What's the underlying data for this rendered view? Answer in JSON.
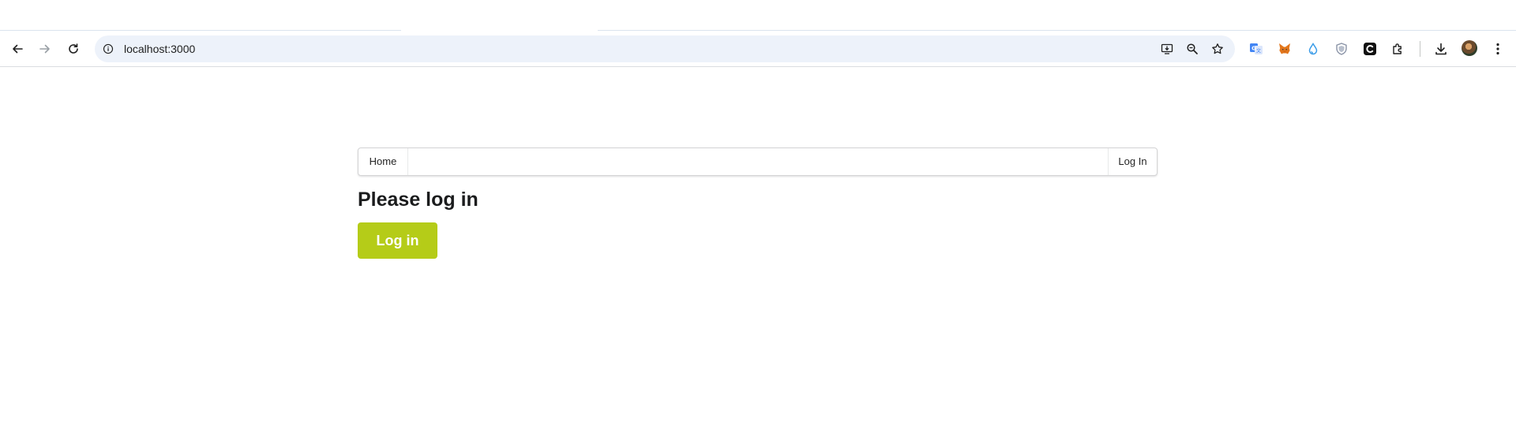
{
  "browser": {
    "url": "localhost:3000",
    "icons": {
      "back": "arrow-left-icon",
      "forward": "arrow-right-icon",
      "reload": "reload-icon",
      "site_info": "info-icon",
      "install": "install-app-icon",
      "zoom": "zoom-icon",
      "bookmark": "star-icon",
      "downloads": "download-icon",
      "menu": "kebab-menu-icon"
    },
    "extensions": [
      "google-translate-icon",
      "metamask-icon",
      "drop-icon",
      "shield-icon",
      "c-extension-icon",
      "puzzle-extensions-icon"
    ]
  },
  "nav": {
    "home": "Home",
    "login": "Log In"
  },
  "page": {
    "heading": "Please log in",
    "login_button": "Log in"
  },
  "colors": {
    "accent": "#b5cc18",
    "omnibox": "#edf2fa",
    "text": "#1b1c1d"
  }
}
